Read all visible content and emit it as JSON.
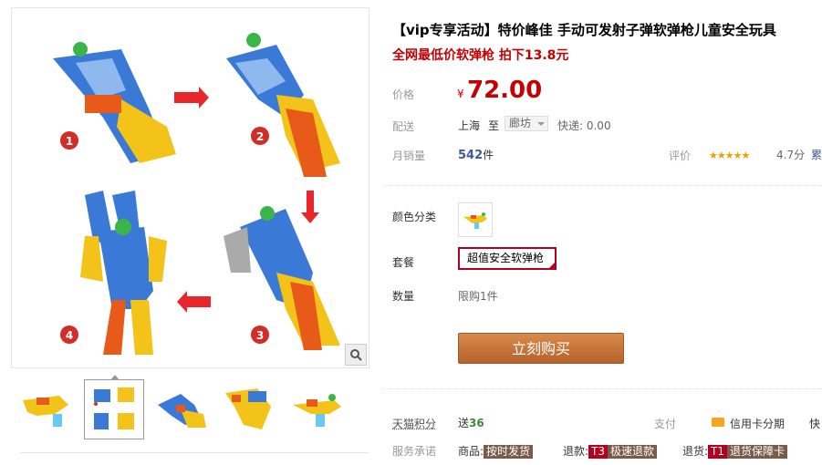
{
  "product": {
    "title": "【vip专享活动】特价峰佳 手动可发射子弹软弹枪儿童安全玩具",
    "subtitle": "全网最低价软弹枪 拍下13.8元"
  },
  "price": {
    "label": "价格",
    "currency": "¥",
    "value": "72.00"
  },
  "shipping": {
    "label": "配送",
    "from": "上海",
    "to_word": "至",
    "dest": "廊坊",
    "express": "快递: 0.00"
  },
  "sales": {
    "label": "月销量",
    "count": "542",
    "unit": "件"
  },
  "review": {
    "label": "评价",
    "stars": "★★★★★",
    "score": "4.7分",
    "more": "累"
  },
  "color": {
    "label": "颜色分类"
  },
  "package": {
    "label": "套餐",
    "option": "超值安全软弹枪"
  },
  "quantity": {
    "label": "数量",
    "limit": "限购1件"
  },
  "buy_button": "立刻购买",
  "points": {
    "label": "天猫积分",
    "prefix": "送",
    "value": "36"
  },
  "payment": {
    "label": "支付",
    "card": "信用卡分期",
    "more": "快"
  },
  "service": {
    "label": "服务承诺",
    "items": [
      {
        "prefix": "商品:",
        "tag": "",
        "text": "按时发货"
      },
      {
        "prefix": "退款:",
        "tag": "T3",
        "text": "极速退款"
      },
      {
        "prefix": "退货:",
        "tag": "T1",
        "text": "退货保障卡"
      }
    ]
  },
  "steps": [
    "1",
    "2",
    "3",
    "4"
  ],
  "colors": {
    "price_red": "#c40000",
    "buy_orange": "#c8753a",
    "link_blue": "#3c5a91"
  }
}
